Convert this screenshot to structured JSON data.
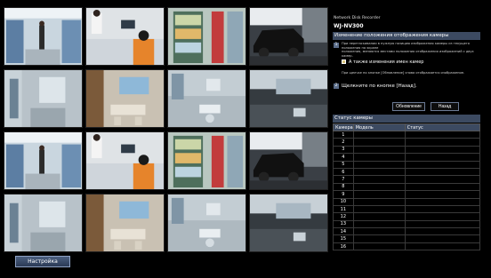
{
  "panel": {
    "product": "Network Disk Recorder",
    "model": "WJ-NV300",
    "change_title": "Изменение положения отображения камеры",
    "step1_text_line1": "При перетаскивании в нужную позицию изображения камеры из текущего положения на экране",
    "step1_text_line2": "положения, меняются местами положения отображения изображений с двух камер.",
    "checkbox_label": "А также изменения имен камер",
    "step1_note": "При щелчке по кнопке [Обновление] снова отображается изображение.",
    "step2_text": "Щелкните по кнопке [Назад].",
    "step1_number": "1",
    "step2_number": "2",
    "update_button": "Обновление",
    "back_button": "Назад",
    "status_title": "Статус камеры",
    "columns": [
      "Камера",
      "Модель",
      "Статус"
    ],
    "rows": [
      "1",
      "2",
      "3",
      "4",
      "5",
      "6",
      "7",
      "8",
      "9",
      "10",
      "11",
      "12",
      "13",
      "14",
      "15",
      "16"
    ]
  },
  "setup_button": "Настройка",
  "cameras": [
    {
      "scene": "store-aisle"
    },
    {
      "scene": "cashier-counter"
    },
    {
      "scene": "drinks-shelf"
    },
    {
      "scene": "parking-car"
    },
    {
      "scene": "office-hall"
    },
    {
      "scene": "meeting-room"
    },
    {
      "scene": "office-corner"
    },
    {
      "scene": "lobby"
    },
    {
      "scene": "store-aisle"
    },
    {
      "scene": "cashier-counter"
    },
    {
      "scene": "drinks-shelf"
    },
    {
      "scene": "parking-car"
    },
    {
      "scene": "office-hall"
    },
    {
      "scene": "meeting-room"
    },
    {
      "scene": "office-corner"
    },
    {
      "scene": "lobby"
    }
  ]
}
